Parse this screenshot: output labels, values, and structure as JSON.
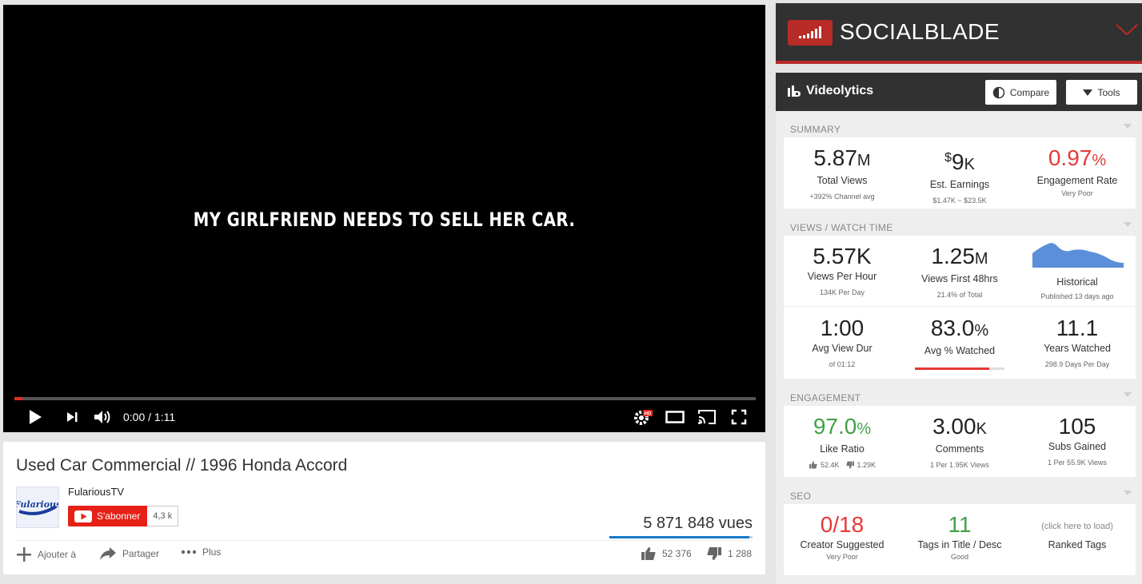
{
  "player": {
    "caption": "MY GIRLFRIEND NEEDS TO SELL HER CAR.",
    "time": "0:00 / 1:11",
    "progress_fraction": 0.011
  },
  "video": {
    "title": "Used Car Commercial // 1996 Honda Accord",
    "channel_name": "FulariousTV",
    "channel_logo_text": "Fularious",
    "subscribe_label": "S'abonner",
    "subscriber_count": "4,3 k",
    "views": "5 871 848 vues",
    "like_bar_fraction": 0.976,
    "actions": {
      "add": "Ajouter à",
      "share": "Partager",
      "more": "Plus",
      "likes": "52 376",
      "dislikes": "1 288"
    }
  },
  "socialblade": {
    "brand": "SOCIALBLADE",
    "panel_title": "Videolytics",
    "compare_label": "Compare",
    "tools_label": "Tools",
    "summary": {
      "label": "SUMMARY",
      "total_views": {
        "value": "5.87",
        "unit": "M",
        "label": "Total Views",
        "sub": "+392% Channel avg"
      },
      "earnings": {
        "prefix": "$",
        "value": "9",
        "unit": "K",
        "label": "Est. Earnings",
        "sub": "$1.47K ~ $23.5K"
      },
      "engagement": {
        "value": "0.97",
        "unit": "%",
        "label": "Engagement Rate",
        "sub": "Very Poor"
      }
    },
    "watch": {
      "label": "VIEWS / WATCH TIME",
      "per_hour": {
        "value": "5.57K",
        "label": "Views Per Hour",
        "sub": "134K Per Day"
      },
      "first48": {
        "value": "1.25",
        "unit": "M",
        "label": "Views First 48hrs",
        "sub": "21.4% of Total"
      },
      "historical": {
        "label": "Historical",
        "sub": "Published 13 days ago"
      },
      "avg_dur": {
        "value": "1:00",
        "label": "Avg View Dur",
        "sub": "of 01:12"
      },
      "avg_pct": {
        "value": "83.0",
        "unit": "%",
        "label": "Avg % Watched",
        "fraction": 0.83
      },
      "years": {
        "value": "11.1",
        "label": "Years Watched",
        "sub": "298.9 Days Per Day"
      }
    },
    "engagement": {
      "label": "ENGAGEMENT",
      "like_ratio": {
        "value": "97.0",
        "unit": "%",
        "label": "Like Ratio",
        "likes": "52.4K",
        "dislikes": "1.29K"
      },
      "comments": {
        "value": "3.00",
        "unit": "K",
        "label": "Comments",
        "sub": "1 Per 1.95K Views"
      },
      "subs": {
        "value": "105",
        "label": "Subs Gained",
        "sub": "1 Per 55.9K Views"
      }
    },
    "seo": {
      "label": "SEO",
      "creator": {
        "value": "0/18",
        "label": "Creator Suggested",
        "sub": "Very Poor"
      },
      "tags": {
        "value": "11",
        "label": "Tags in Title / Desc",
        "sub": "Good"
      },
      "ranked": {
        "hint": "(click here to load)",
        "label": "Ranked Tags"
      }
    }
  },
  "colors": {
    "accent_red": "#b92b27",
    "youtube_red": "#e62117",
    "good_green": "#43a047",
    "bad_red": "#e53935"
  }
}
